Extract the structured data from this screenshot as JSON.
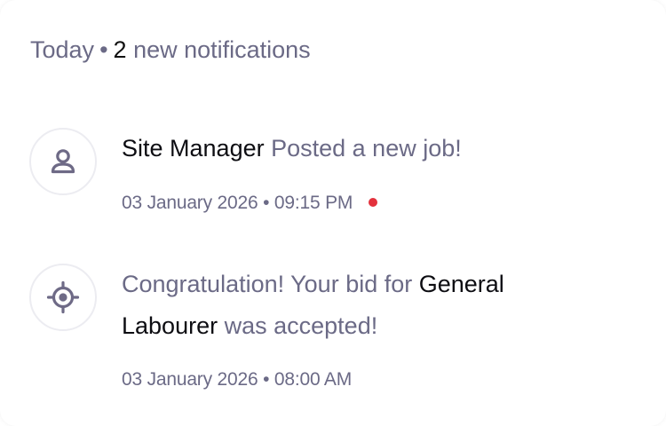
{
  "header": {
    "day": "Today",
    "separator": "•",
    "count": "2",
    "suffix": "new notifications"
  },
  "notifications": [
    {
      "icon": "user-icon",
      "actor": "Site Manager",
      "message": "Posted a new job!",
      "date": "03 January 2026",
      "separator": "•",
      "time": "09:15 PM",
      "unread": true
    },
    {
      "icon": "target-icon",
      "prefix": "Congratulation! Your bid for",
      "job": "General Labourer",
      "suffix": "was accepted!",
      "date": "03 January 2026",
      "separator": "•",
      "time": "08:00 AM",
      "unread": false
    }
  ],
  "colors": {
    "muted_text": "#6b6a86",
    "strong_text": "#0d0d12",
    "unread_dot": "#e3313c",
    "icon": "#6e6a86",
    "avatar_border": "#ececf1"
  }
}
